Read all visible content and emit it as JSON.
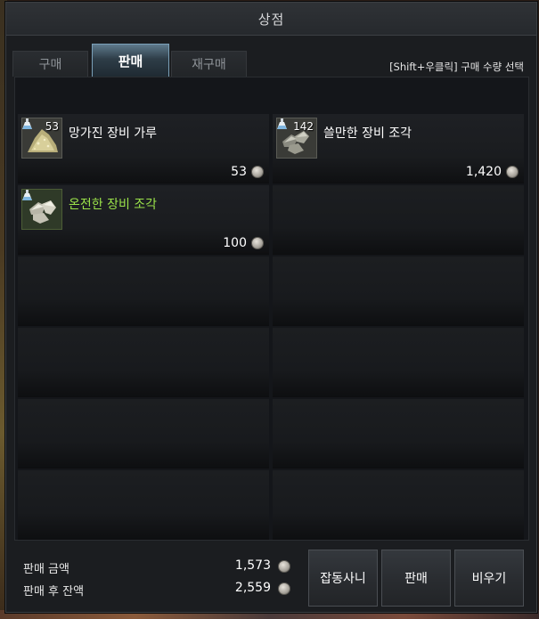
{
  "window": {
    "title": "상점"
  },
  "tabs": [
    {
      "label": "구매",
      "active": false
    },
    {
      "label": "판매",
      "active": true
    },
    {
      "label": "재구매",
      "active": false
    }
  ],
  "hint": "[Shift+우클릭] 구매 수량 선택",
  "items": [
    {
      "name": "망가진 장비 가루",
      "qty": "53",
      "price": "53",
      "icon": "dust-icon",
      "grade_color": "#ffffff"
    },
    {
      "name": "쓸만한 장비 조각",
      "qty": "142",
      "price": "1,420",
      "icon": "fragment-icon",
      "grade_color": "#ffffff"
    },
    {
      "name": "온전한 장비 조각",
      "qty": "",
      "price": "100",
      "icon": "fragment-icon",
      "grade_color": "#9be34a"
    }
  ],
  "summary": {
    "sale_amount_label": "판매 금액",
    "sale_amount_value": "1,573",
    "balance_after_label": "판매 후 잔액",
    "balance_after_value": "2,559"
  },
  "buttons": {
    "junk": "잡동사니",
    "sell": "판매",
    "clear": "비우기"
  }
}
